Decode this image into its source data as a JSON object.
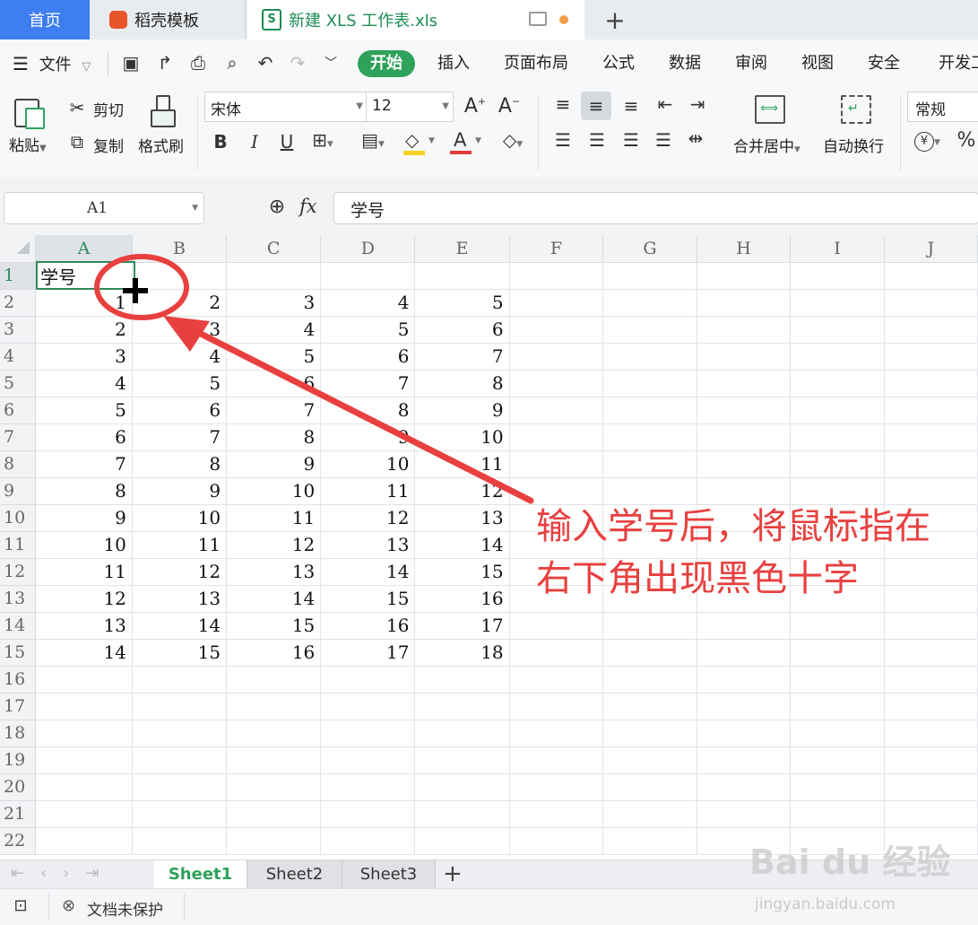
{
  "tabs": {
    "home": "首页",
    "template": "稻壳模板",
    "file": "新建 XLS 工作表.xls",
    "new_tab": "+"
  },
  "menu": {
    "file": "文件",
    "start": "开始",
    "insert": "插入",
    "page_layout": "页面布局",
    "formula": "公式",
    "data": "数据",
    "review": "审阅",
    "view": "视图",
    "security": "安全",
    "developer": "开发工"
  },
  "ribbon": {
    "paste": "粘贴",
    "cut": "剪切",
    "copy": "复制",
    "format_painter": "格式刷",
    "font_name": "宋体",
    "font_size": "12",
    "bold": "B",
    "italic": "I",
    "underline": "U",
    "font_color_glyph": "A",
    "merge_center": "合并居中",
    "wrap_text": "自动换行",
    "number_format": "常规",
    "currency_glyph": "¥",
    "percent_glyph": "%"
  },
  "formula_bar": {
    "name_box": "A1",
    "fx": "fx",
    "content": "学号"
  },
  "grid": {
    "columns": [
      "A",
      "B",
      "C",
      "D",
      "E",
      "F",
      "G",
      "H",
      "I",
      "J"
    ],
    "rows": [
      [
        "学号",
        "",
        "",
        "",
        "",
        "",
        "",
        "",
        "",
        ""
      ],
      [
        "1",
        "2",
        "3",
        "4",
        "5",
        "",
        "",
        "",
        "",
        ""
      ],
      [
        "2",
        "3",
        "4",
        "5",
        "6",
        "",
        "",
        "",
        "",
        ""
      ],
      [
        "3",
        "4",
        "5",
        "6",
        "7",
        "",
        "",
        "",
        "",
        ""
      ],
      [
        "4",
        "5",
        "6",
        "7",
        "8",
        "",
        "",
        "",
        "",
        ""
      ],
      [
        "5",
        "6",
        "7",
        "8",
        "9",
        "",
        "",
        "",
        "",
        ""
      ],
      [
        "6",
        "7",
        "8",
        "9",
        "10",
        "",
        "",
        "",
        "",
        ""
      ],
      [
        "7",
        "8",
        "9",
        "10",
        "11",
        "",
        "",
        "",
        "",
        ""
      ],
      [
        "8",
        "9",
        "10",
        "11",
        "12",
        "",
        "",
        "",
        "",
        ""
      ],
      [
        "9",
        "10",
        "11",
        "12",
        "13",
        "",
        "",
        "",
        "",
        ""
      ],
      [
        "10",
        "11",
        "12",
        "13",
        "14",
        "",
        "",
        "",
        "",
        ""
      ],
      [
        "11",
        "12",
        "13",
        "14",
        "15",
        "",
        "",
        "",
        "",
        ""
      ],
      [
        "12",
        "13",
        "14",
        "15",
        "16",
        "",
        "",
        "",
        "",
        ""
      ],
      [
        "13",
        "14",
        "15",
        "16",
        "17",
        "",
        "",
        "",
        "",
        ""
      ],
      [
        "14",
        "15",
        "16",
        "17",
        "18",
        "",
        "",
        "",
        "",
        ""
      ],
      [
        "",
        "",
        "",
        "",
        "",
        "",
        "",
        "",
        "",
        ""
      ],
      [
        "",
        "",
        "",
        "",
        "",
        "",
        "",
        "",
        "",
        ""
      ],
      [
        "",
        "",
        "",
        "",
        "",
        "",
        "",
        "",
        "",
        ""
      ],
      [
        "",
        "",
        "",
        "",
        "",
        "",
        "",
        "",
        "",
        ""
      ],
      [
        "",
        "",
        "",
        "",
        "",
        "",
        "",
        "",
        "",
        ""
      ],
      [
        "",
        "",
        "",
        "",
        "",
        "",
        "",
        "",
        "",
        ""
      ],
      [
        "",
        "",
        "",
        "",
        "",
        "",
        "",
        "",
        "",
        ""
      ]
    ]
  },
  "sheets": [
    "Sheet1",
    "Sheet2",
    "Sheet3"
  ],
  "active_sheet": "Sheet1",
  "status": {
    "protection": "文档未保护"
  },
  "annotation": {
    "line1": "输入学号后，将鼠标指在",
    "line2": "右下角出现黑色十字"
  },
  "watermark": {
    "brand": "Bai du 经验",
    "url": "jingyan.baidu.com"
  },
  "colors": {
    "accent_green": "#2ea15a",
    "tab_blue": "#3d7ef0",
    "annotation_red": "#e8403f"
  }
}
